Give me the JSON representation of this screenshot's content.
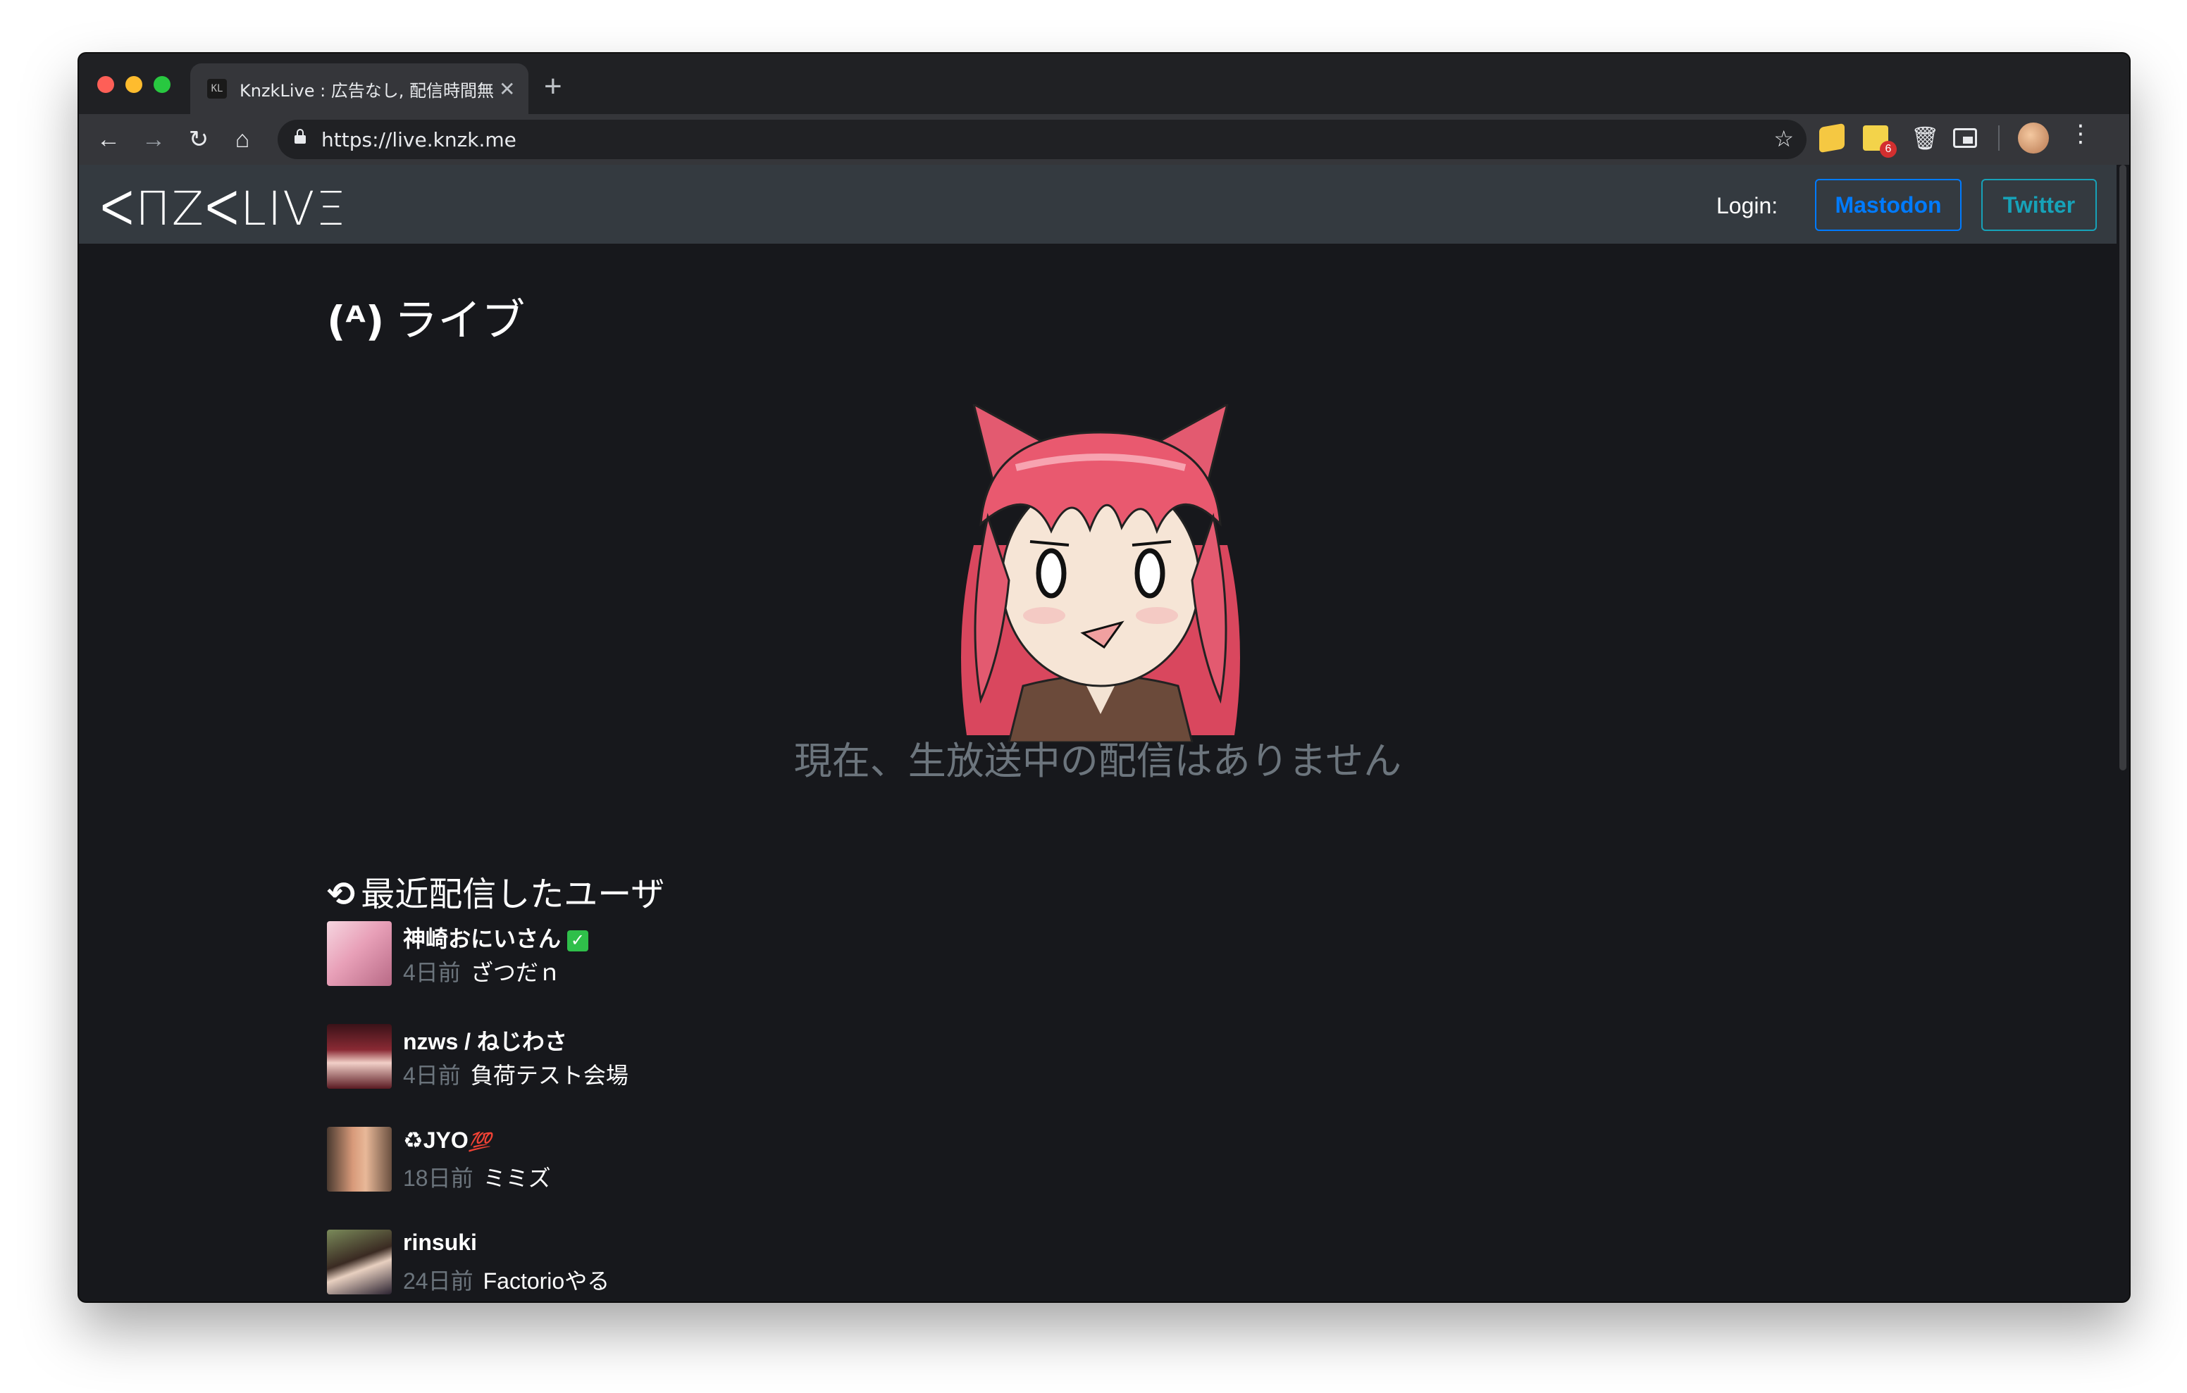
{
  "browser": {
    "tab_title": "KnzkLive : 広告なし, 配信時間無制限",
    "tab_favicon": "KL",
    "tab_close": "✕",
    "new_tab": "+",
    "url": "https://live.knzk.me",
    "back": "←",
    "forward": "→",
    "reload": "↻",
    "home": "⌂",
    "star": "☆",
    "ext_badge": "6",
    "trash": "🗑",
    "menu": "⋮"
  },
  "site": {
    "logo": "ᐸПZᐸLIVΞ",
    "login_label": "Login:",
    "mastodon_label": "Mastodon",
    "twitter_label": "Twitter",
    "live_icon": "(ᴬ)",
    "live_heading": "ライブ",
    "no_stream": "現在、生放送中の配信はありません",
    "recent_icon": "⟲",
    "recent_heading": "最近配信したユーザ"
  },
  "recent_users": [
    {
      "name": "神崎おにいさん",
      "badge": "✓",
      "ago": "4日前",
      "title": "ざつだｎ"
    },
    {
      "name": "nzws / ねじわさ",
      "ago": "4日前",
      "title": "負荷テスト会場"
    },
    {
      "name": "♻JYO",
      "badge": "💯",
      "ago": "18日前",
      "title": "ミミズ"
    },
    {
      "name": "rinsuki",
      "ago": "24日前",
      "title": "Factorioやる"
    }
  ],
  "colors": {
    "page_bg": "#17181c",
    "navbar_bg": "#343a40",
    "mastodon": "#007bff",
    "twitter": "#17a2b8",
    "muted": "#6c757d"
  }
}
